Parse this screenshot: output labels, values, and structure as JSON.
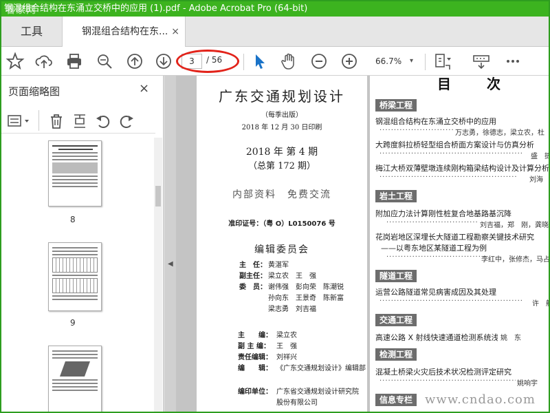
{
  "window": {
    "title": "钢混组合结构在东涌立交桥中的应用 (1).pdf - Adobe Acrobat Pro (64-bit)",
    "watermark": "看家网"
  },
  "tabs": {
    "tools_label": "工具",
    "doc_label": "钢混组合结构在东...",
    "close": "×"
  },
  "toolbar": {
    "current_page": "3",
    "total_pages": "/ 56",
    "zoom": "66.7%"
  },
  "sidebar": {
    "title": "页面缩略图",
    "close": "×",
    "thumbnails": [
      {
        "label": "8"
      },
      {
        "label": "9"
      },
      {
        "label": ""
      }
    ]
  },
  "left_page": {
    "journal_title": "广东交通规划设计",
    "frequency": "（每季出版）",
    "print_date": "2018 年 12 月 30 日印刷",
    "issue": "2018 年 第 4 期",
    "total_issue": "（总第 172 期）",
    "notice": "内部资料　免费交流",
    "permit": "准印证号：（粤 O）L0150076 号",
    "committee_title": "编辑委员会",
    "committee": [
      {
        "role": "主　任：",
        "names": "黄湛军"
      },
      {
        "role": "副主任：",
        "names": "梁立农　王　强"
      },
      {
        "role": "委　员：",
        "names": "谢伟强　彭向荣　陈潮锐"
      },
      {
        "role": "",
        "names": "孙向东　王景奇　陈新富"
      },
      {
        "role": "",
        "names": "梁志勇　刘吉福"
      }
    ],
    "staff": [
      {
        "role": "主　　编：",
        "names": "梁立农"
      },
      {
        "role": "副 主 编：",
        "names": "王　强"
      },
      {
        "role": "责任编辑：",
        "names": "刘祥兴"
      },
      {
        "role": "编　　辑：",
        "names": "《广东交通规划设计》编辑部"
      }
    ],
    "publisher_role": "编印单位：",
    "publisher_line1": "广东省交通规划设计研究院",
    "publisher_line2": "股份有限公司"
  },
  "right_page": {
    "toc_title": "目　　次",
    "sections": [
      {
        "heading": "桥梁工程",
        "items": [
          {
            "title": "钢混组合结构在东涌立交桥中的应用",
            "authors": "万志勇，徐德志，梁立农，杜　毅"
          },
          {
            "title": "大跨度斜拉桥轻型组合桥面方案设计与仿真分析",
            "authors": "盛　捷"
          },
          {
            "title": "梅江大桥双薄壁墩连续刚构箱梁结构设计及计算分析",
            "authors": "刘海"
          }
        ]
      },
      {
        "heading": "岩土工程",
        "items": [
          {
            "title": "附加应力法计算刚性桩复合地基路基沉降",
            "authors": "刘吉福，郑　刚，龚晓南"
          },
          {
            "title": "花岗岩地区深埋长大隧道工程勘察关键技术研究",
            "subtitle": "——以粤东地区某隧道工程为例",
            "authors": "李红中，张修杰，马占武"
          }
        ]
      },
      {
        "heading": "隧道工程",
        "items": [
          {
            "title": "运营公路隧道常见病害成因及其处理",
            "authors": "许　航"
          }
        ]
      },
      {
        "heading": "交通工程",
        "items": [
          {
            "title": "高速公路 X 射线快速通道检测系统浅析",
            "authors": "姚　东"
          }
        ]
      },
      {
        "heading": "检测工程",
        "items": [
          {
            "title": "混凝土桥梁火灾后技术状况检测评定研究",
            "authors": "姚响宇"
          }
        ]
      },
      {
        "heading": "信息专栏",
        "items": []
      }
    ]
  },
  "footer_watermark": "www.cndao.com"
}
